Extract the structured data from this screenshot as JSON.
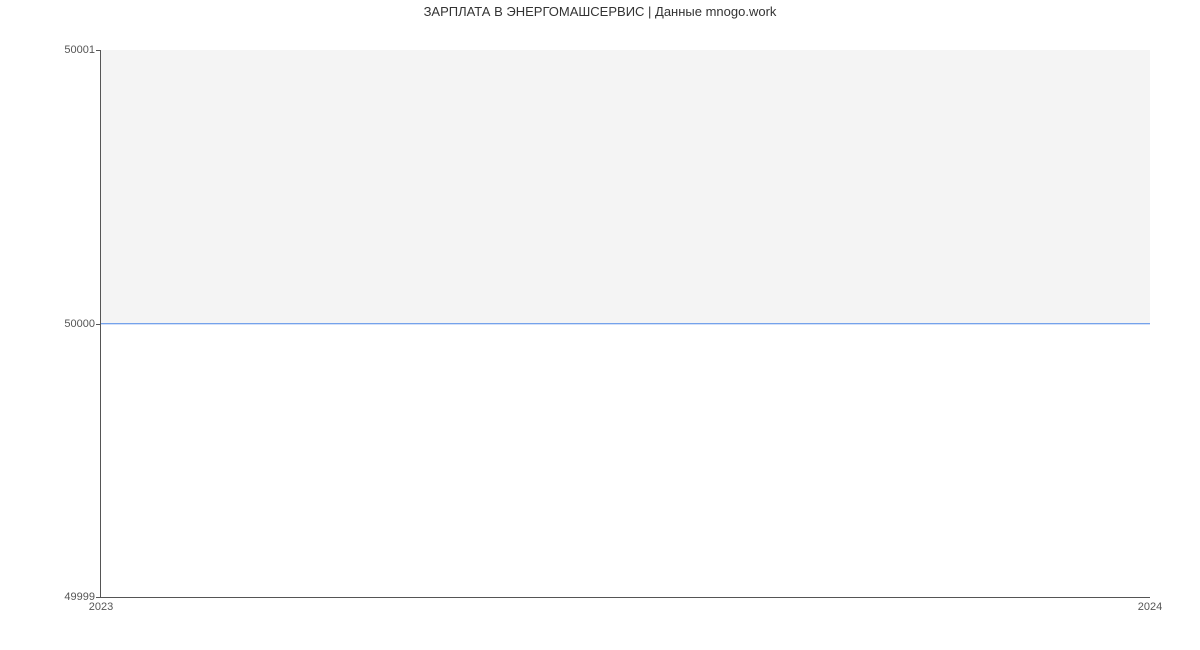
{
  "chart_data": {
    "type": "line",
    "title": "ЗАРПЛАТА В ЭНЕРГОМАШСЕРВИС | Данные mnogo.work",
    "x": [
      "2023",
      "2024"
    ],
    "values": [
      50000,
      50000
    ],
    "xlabel": "",
    "ylabel": "",
    "ylim": [
      49999,
      50001
    ],
    "xticks": [
      "2023",
      "2024"
    ],
    "yticks": [
      "49999",
      "50000",
      "50001"
    ],
    "line_color": "#4a86e8",
    "fill_above_color": "#f4f4f4"
  }
}
